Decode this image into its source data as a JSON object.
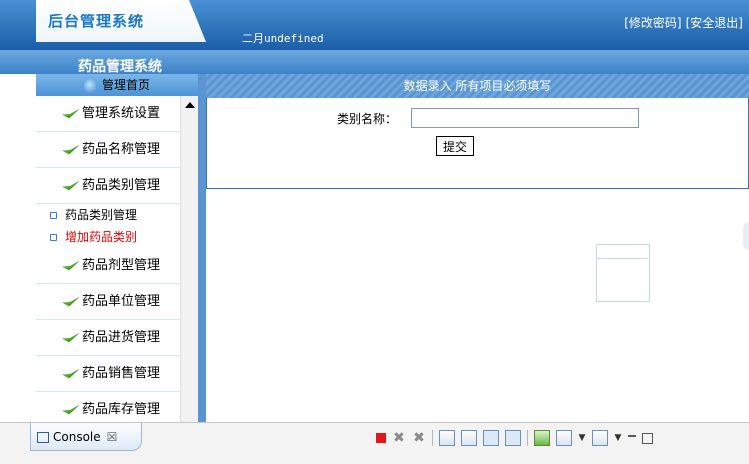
{
  "header": {
    "logo": "后台管理系统",
    "date": "二月undefined",
    "links": [
      "[修改密码]",
      "[安全退出]"
    ]
  },
  "title_strip": {
    "system_title": "药品管理系统"
  },
  "sidebar": {
    "home": "管理首页",
    "items": [
      {
        "label": "管理系统设置"
      },
      {
        "label": "药品名称管理"
      },
      {
        "label": "药品类别管理"
      }
    ],
    "subitems": [
      {
        "label": "药品类别管理",
        "highlight": false
      },
      {
        "label": "增加药品类别",
        "highlight": true
      }
    ],
    "items_after": [
      {
        "label": "药品剂型管理"
      },
      {
        "label": "药品单位管理"
      },
      {
        "label": "药品进货管理"
      },
      {
        "label": "药品销售管理"
      },
      {
        "label": "药品库存管理"
      }
    ]
  },
  "main": {
    "panel_title": "数据录入 所有项目必须填写",
    "form": {
      "label": "类别名称：",
      "value": "",
      "submit": "提交"
    }
  },
  "console": {
    "tab_label": "Console",
    "close_glyph": "☒",
    "colors": {
      "accent": "#5b95d1",
      "stop": "#e01818",
      "highlight_text": "#e00000"
    }
  }
}
